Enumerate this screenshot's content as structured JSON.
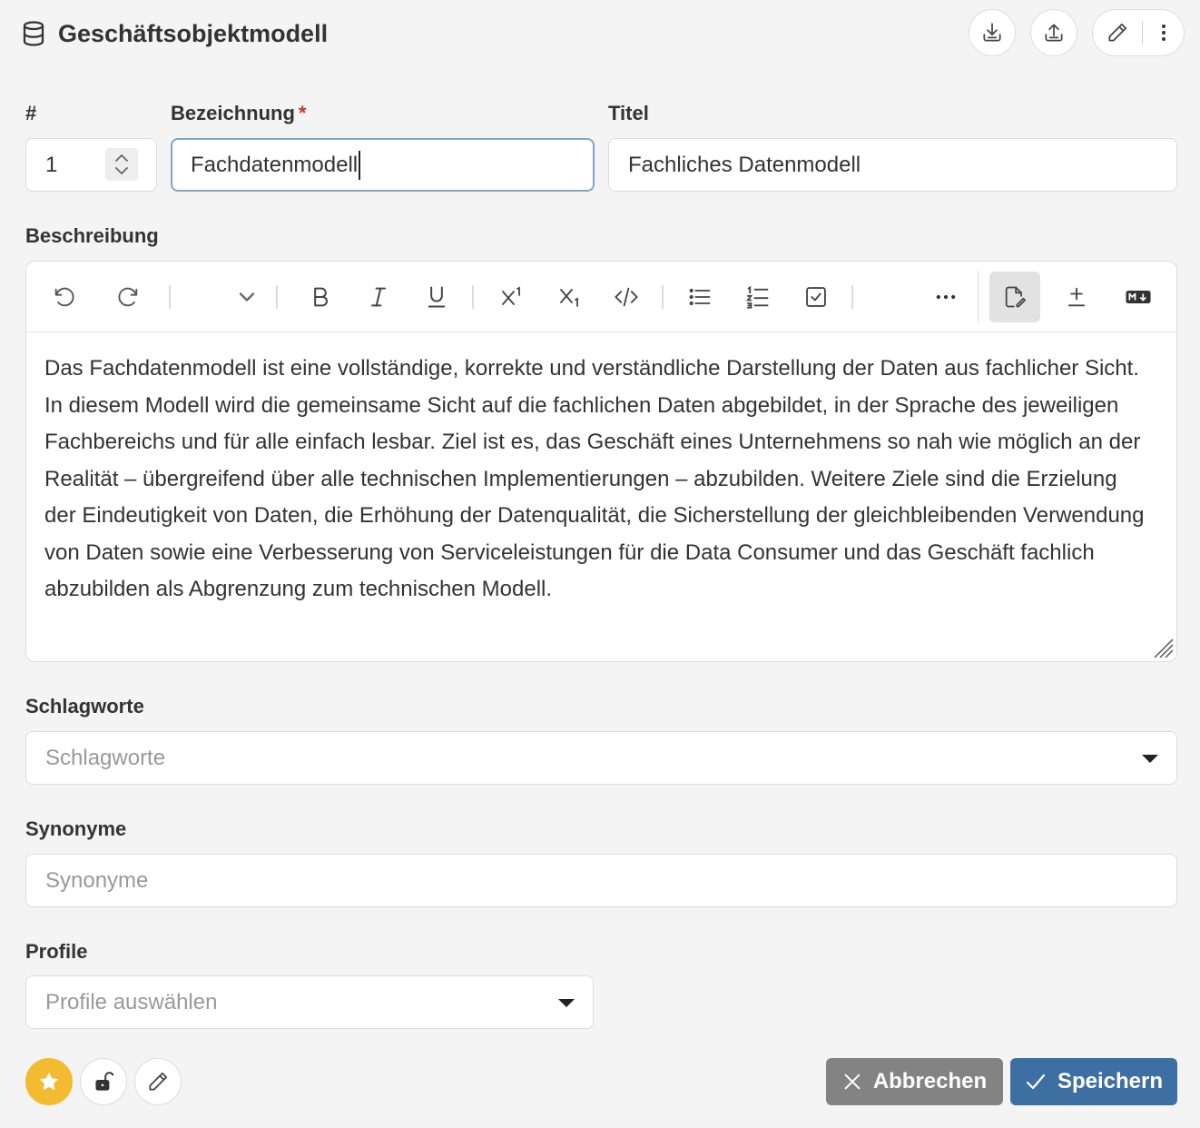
{
  "header": {
    "title": "Geschäftsobjektmodell",
    "icons": [
      "database-icon",
      "download-icon",
      "upload-icon",
      "pencil-icon",
      "more-vertical-icon"
    ]
  },
  "form": {
    "number": {
      "label": "#",
      "value": "1"
    },
    "bezeichnung": {
      "label": "Bezeichnung",
      "required_mark": "*",
      "value": "Fachdatenmodell"
    },
    "titel": {
      "label": "Titel",
      "value": "Fachliches Datenmodell"
    },
    "beschreibung": {
      "label": "Beschreibung",
      "toolbar": [
        "undo",
        "redo",
        "block-type",
        "bold",
        "italic",
        "underline",
        "superscript",
        "subscript",
        "code",
        "bullet-list",
        "numbered-list",
        "checklist",
        "more",
        "rich-text-mode",
        "diff-mode",
        "markdown-mode"
      ],
      "text": "Das Fachdatenmodell ist eine vollständige, korrekte und verständliche Darstellung der Daten aus fachlicher Sicht. In diesem Modell wird die gemeinsame Sicht auf die fachlichen Daten abgebildet, in der Sprache des jeweiligen Fachbereichs und für alle einfach lesbar. Ziel ist es, das Geschäft eines Unternehmens so nah wie möglich an der Realität – übergreifend über alle technischen Implementierungen – abzubilden. Weitere Ziele sind die Erzielung der Eindeutigkeit von Daten, die Erhöhung der Datenqualität, die Sicherstellung der gleichbleibenden Verwendung von Daten sowie eine Verbesserung von Serviceleistungen für die Data Consumer und das Geschäft fachlich abzubilden als Abgrenzung zum technischen Modell."
    },
    "schlagworte": {
      "label": "Schlagworte",
      "placeholder": "Schlagworte"
    },
    "synonyme": {
      "label": "Synonyme",
      "placeholder": "Synonyme"
    },
    "profile": {
      "label": "Profile",
      "placeholder": "Profile auswählen"
    }
  },
  "footer": {
    "cancel_label": "Abbrechen",
    "save_label": "Speichern",
    "accent": "#3e6fa3",
    "cancel_color": "#838383",
    "star_color": "#f3bb2f"
  }
}
